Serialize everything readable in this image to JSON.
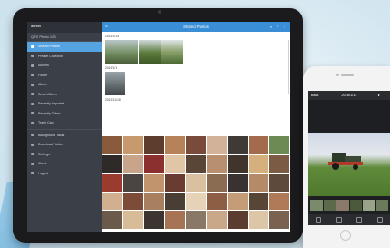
{
  "tablet": {
    "sidebar": {
      "header": "admin",
      "subheader": "QTS Photo 123",
      "items": [
        {
          "label": "Shared Photos",
          "active": true
        },
        {
          "label": "Private Collection",
          "active": false
        },
        {
          "label": "Albums",
          "active": false
        },
        {
          "label": "Folder",
          "active": false
        },
        {
          "label": "Album",
          "active": false
        },
        {
          "label": "Smart Album",
          "active": false
        },
        {
          "label": "Recently Imported",
          "active": false
        },
        {
          "label": "Recently Taken",
          "active": false
        },
        {
          "label": "Trash Can",
          "active": false
        }
      ],
      "items_bottom": [
        {
          "label": "Background Tasks"
        },
        {
          "label": "Download Folder"
        },
        {
          "label": "Settings"
        },
        {
          "label": "About"
        },
        {
          "label": "Logout"
        }
      ]
    },
    "topbar": {
      "menu_icon": "≡",
      "title": "Shared Photos",
      "tools": "⌕ ⬆ ⋮"
    },
    "dates": [
      "2016/1/14",
      "2016/1/1",
      "2015/11/18"
    ]
  },
  "phone": {
    "topbar": {
      "left": "Back",
      "title": "2016/1/14",
      "right": "⬆ ⋮"
    }
  },
  "colors": {
    "accent": "#3a8ed6",
    "sidebar": "#3b3f47",
    "active_item": "#55a3e0",
    "device_frame": "#1b1b1d"
  }
}
